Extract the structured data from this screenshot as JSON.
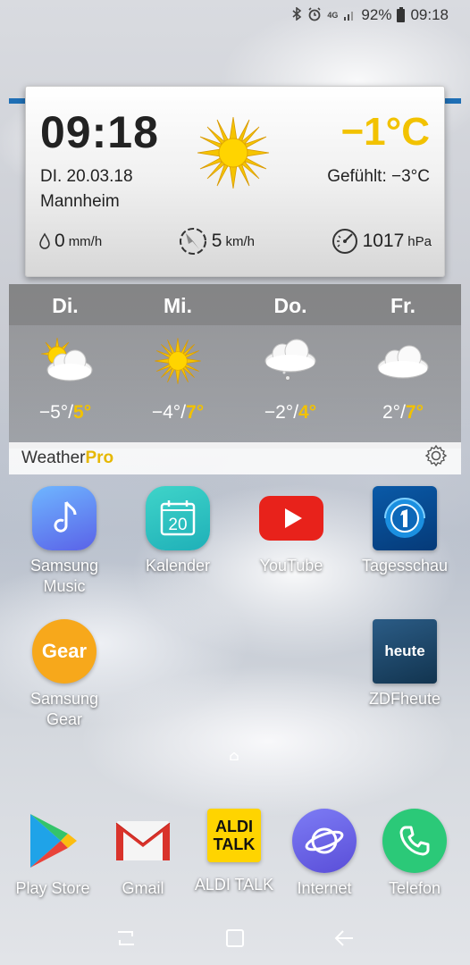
{
  "status_bar": {
    "icons": [
      "bluetooth-icon",
      "alarm-icon",
      "4g-icon",
      "signal-icon"
    ],
    "network": "4G",
    "battery": "92%",
    "time": "09:18"
  },
  "weather_widget": {
    "time": "09:18",
    "date": "DI. 20.03.18",
    "city": "Mannheim",
    "temperature": "−1°C",
    "felt": "Gefühlt: −3°C",
    "precipitation_value": "0",
    "precipitation_unit": "mm/h",
    "wind_value": "5",
    "wind_unit": "km/h",
    "pressure_value": "1017",
    "pressure_unit": "hPa",
    "accent_color": "#f2c200",
    "forecast": [
      {
        "day": "Di.",
        "icon": "partly-sunny-icon",
        "low": "−5°/",
        "high": "5°"
      },
      {
        "day": "Mi.",
        "icon": "sun-icon",
        "low": "−4°/",
        "high": "7°"
      },
      {
        "day": "Do.",
        "icon": "cloud-drizzle-icon",
        "low": "−2°/",
        "high": "4°"
      },
      {
        "day": "Fr.",
        "icon": "cloud-icon",
        "low": "2°/",
        "high": "7°"
      }
    ],
    "brand_main": "Weather",
    "brand_pro": "Pro"
  },
  "apps": [
    {
      "label": "Samsung Music",
      "line1": "Samsung",
      "line2": "Music",
      "icon": "music-note-icon"
    },
    {
      "label": "Kalender",
      "line1": "Kalender",
      "line2": "",
      "icon": "calendar-icon",
      "icon_text": "20"
    },
    {
      "label": "YouTube",
      "line1": "YouTube",
      "line2": "",
      "icon": "youtube-icon"
    },
    {
      "label": "Tagesschau",
      "line1": "Tagesschau",
      "line2": "",
      "icon": "tagesschau-icon"
    },
    {
      "label": "Samsung Gear",
      "line1": "Samsung",
      "line2": "Gear",
      "icon": "gear-app-icon",
      "icon_text": "Gear"
    },
    {
      "label": "ZDFheute",
      "line1": "ZDFheute",
      "line2": "",
      "icon": "zdfheute-icon",
      "icon_text": "heute"
    }
  ],
  "dock": [
    {
      "label": "Play Store",
      "icon": "play-store-icon"
    },
    {
      "label": "Gmail",
      "icon": "gmail-icon"
    },
    {
      "label": "ALDI TALK",
      "icon": "aldi-talk-icon",
      "icon_text_1": "ALDI",
      "icon_text_2": "TALK"
    },
    {
      "label": "Internet",
      "icon": "internet-icon"
    },
    {
      "label": "Telefon",
      "icon": "phone-icon"
    }
  ],
  "nav": [
    "recent-apps-icon",
    "home-icon",
    "back-icon"
  ]
}
